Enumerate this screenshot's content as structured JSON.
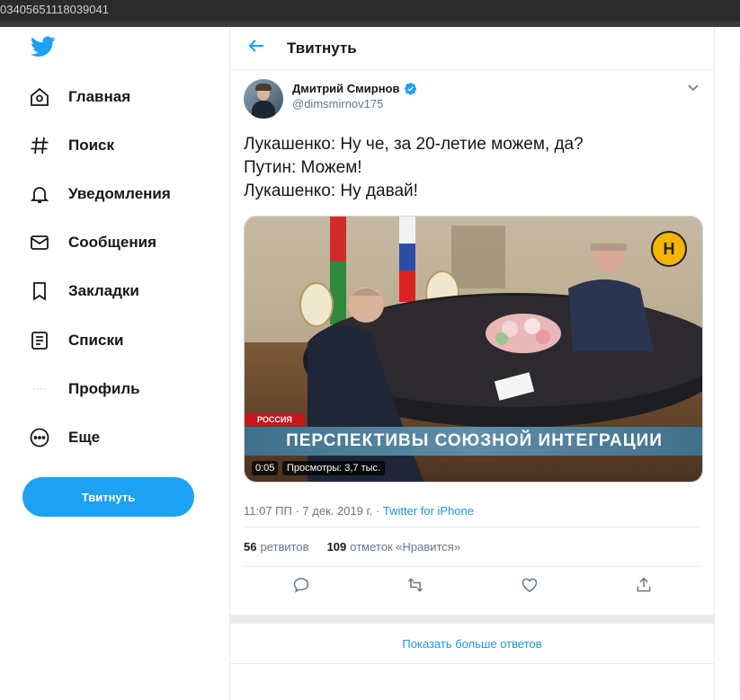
{
  "window": {
    "title": "03405651118039041"
  },
  "sidebar": {
    "logo_icon": "twitter-bird-icon",
    "items": [
      {
        "label": "Главная",
        "icon": "home-icon"
      },
      {
        "label": "Поиск",
        "icon": "hashtag-icon"
      },
      {
        "label": "Уведомления",
        "icon": "bell-icon"
      },
      {
        "label": "Сообщения",
        "icon": "envelope-icon"
      },
      {
        "label": "Закладки",
        "icon": "bookmark-icon"
      },
      {
        "label": "Списки",
        "icon": "list-icon"
      },
      {
        "label": "Профиль",
        "icon": "profile-icon"
      },
      {
        "label": "Еще",
        "icon": "more-dots-icon"
      }
    ],
    "tweet_button": "Твитнуть"
  },
  "header": {
    "title": "Твитнуть",
    "back_icon": "arrow-left-icon"
  },
  "tweet": {
    "author": {
      "display_name": "Дмитрий Смирнов",
      "handle": "@dimsmirnov175",
      "verified": true
    },
    "text_lines": [
      "Лукашенко: Ну че, за 20-летие можем, да?",
      "Путин: Можем!",
      "Лукашенко: Ну давай!"
    ],
    "media": {
      "duration": "0:05",
      "views": "Просмотры: 3,7 тыс.",
      "banner": "ПЕРСПЕКТИВЫ СОЮЗНОЙ ИНТЕГРАЦИИ",
      "tag": "РОССИЯ"
    },
    "timestamp": "11:07 ПП · 7 дек. 2019 г. · ",
    "source": "Twitter for iPhone",
    "retweets_count": "56",
    "retweets_label": "ретвитов",
    "likes_count": "109",
    "likes_label": "отметок «Нравится»"
  },
  "more_replies": "Показать больше ответов",
  "colors": {
    "accent": "#1da1f2",
    "link": "#1b95e0",
    "text": "#14171a",
    "muted": "#657786",
    "border": "#e6ecf0"
  }
}
